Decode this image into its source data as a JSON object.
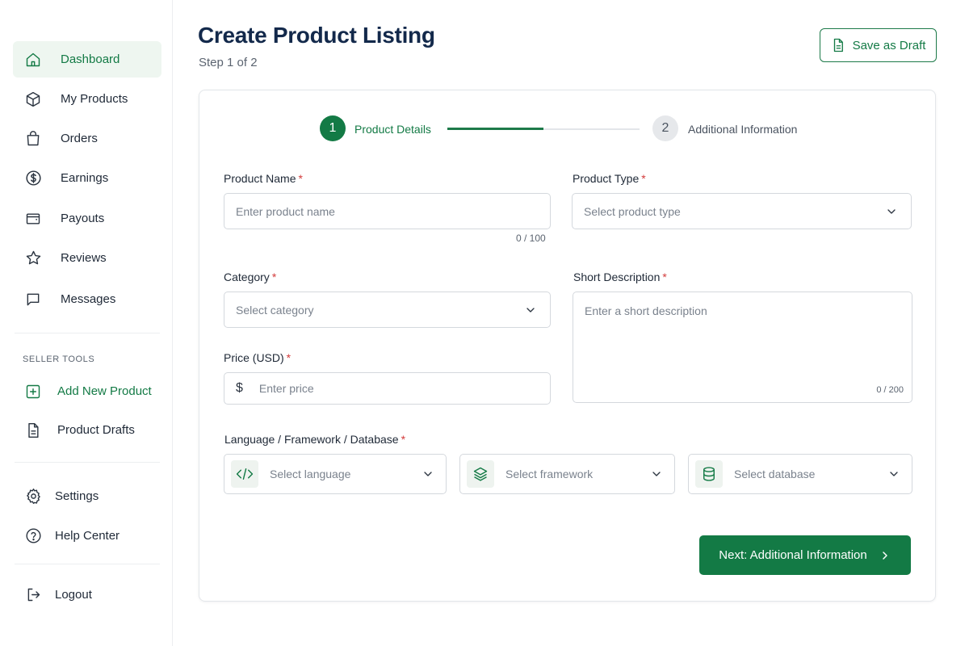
{
  "sidebar": {
    "items": [
      {
        "label": "Dashboard",
        "icon": "home-icon"
      },
      {
        "label": "My Products",
        "icon": "box-icon"
      },
      {
        "label": "Orders",
        "icon": "shopping-bag-icon"
      },
      {
        "label": "Earnings",
        "icon": "dollar-circle-icon"
      },
      {
        "label": "Payouts",
        "icon": "wallet-icon"
      },
      {
        "label": "Reviews",
        "icon": "star-icon"
      },
      {
        "label": "Messages",
        "icon": "message-icon"
      }
    ],
    "section_label": "SELLER TOOLS",
    "tools": [
      {
        "label": "Add New Product",
        "icon": "plus-square-icon"
      },
      {
        "label": "Product Drafts",
        "icon": "document-icon"
      }
    ],
    "bottom": [
      {
        "label": "Settings",
        "icon": "gear-icon"
      },
      {
        "label": "Help Center",
        "icon": "help-circle-icon"
      }
    ],
    "logout": {
      "label": "Logout",
      "icon": "logout-icon"
    }
  },
  "header": {
    "title": "Create Product Listing",
    "subtitle": "Step 1 of 2",
    "save_draft_label": "Save as Draft"
  },
  "stepper": {
    "steps": [
      {
        "number": "1",
        "label": "Product Details"
      },
      {
        "number": "2",
        "label": "Additional Information"
      }
    ],
    "progress": 0.5
  },
  "form": {
    "product_name": {
      "label": "Product Name",
      "required": "*",
      "placeholder": "Enter product name",
      "counter": "0 / 100"
    },
    "product_type": {
      "label": "Product Type",
      "required": "*",
      "placeholder": "Select product type"
    },
    "category": {
      "label": "Category",
      "required": "*",
      "placeholder": "Select category"
    },
    "short_description": {
      "label": "Short Description",
      "required": "*",
      "placeholder": "Enter a short description",
      "counter": "0 / 200"
    },
    "price": {
      "label": "Price (USD)",
      "required": "*",
      "currency_symbol": "$",
      "placeholder": "Enter price"
    },
    "tech": {
      "label": "Language / Framework / Database",
      "required": "*",
      "language_placeholder": "Select language",
      "framework_placeholder": "Select framework",
      "database_placeholder": "Select database"
    }
  },
  "next_button_label": "Next: Additional Information",
  "colors": {
    "brand": "#137a45",
    "title": "#13294b",
    "required": "#d33b3b"
  }
}
